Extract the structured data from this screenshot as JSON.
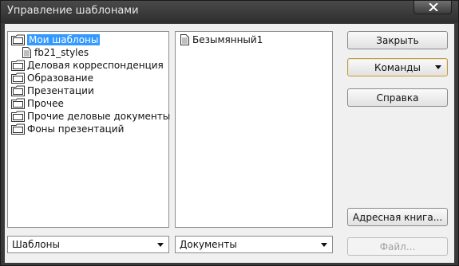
{
  "window": {
    "title": "Управление шаблонами"
  },
  "categories": [
    {
      "label": "Мои шаблоны",
      "type": "folder",
      "selected": true,
      "level": 0
    },
    {
      "label": "fb21_styles",
      "type": "doc",
      "selected": false,
      "level": 1
    },
    {
      "label": "Деловая корреспонденция",
      "type": "folder",
      "selected": false,
      "level": 0
    },
    {
      "label": "Образование",
      "type": "folder",
      "selected": false,
      "level": 0
    },
    {
      "label": "Презентации",
      "type": "folder",
      "selected": false,
      "level": 0
    },
    {
      "label": "Прочее",
      "type": "folder",
      "selected": false,
      "level": 0
    },
    {
      "label": "Прочие деловые документы",
      "type": "folder",
      "selected": false,
      "level": 0
    },
    {
      "label": "Фоны презентаций",
      "type": "folder",
      "selected": false,
      "level": 0
    }
  ],
  "documents": [
    {
      "label": "Безымянный1",
      "type": "doc"
    }
  ],
  "buttons": {
    "close": "Закрыть",
    "commands": "Команды",
    "help": "Справка",
    "address_book": "Адресная книга...",
    "file": "Файл..."
  },
  "combos": {
    "left": "Шаблоны",
    "right": "Документы"
  },
  "colors": {
    "selection": "#3399ff",
    "titlebar": "#3a3a3a"
  }
}
